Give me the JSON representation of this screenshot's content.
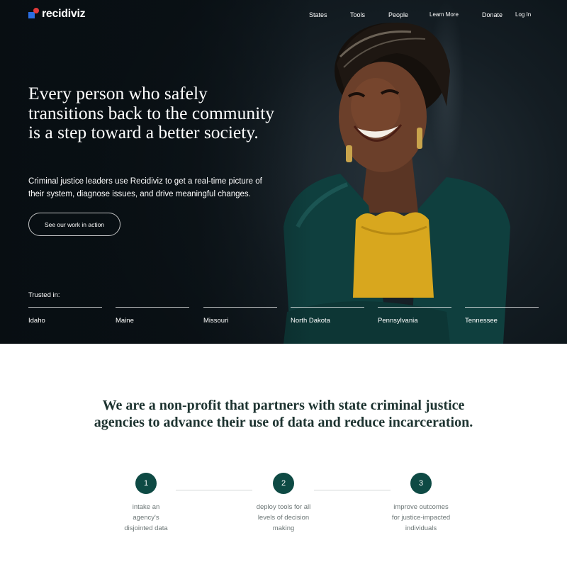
{
  "brand": {
    "name": "recidiviz",
    "colors": {
      "blue": "#2b6de0",
      "red": "#e13a3a"
    }
  },
  "nav": {
    "items": [
      {
        "label": "States"
      },
      {
        "label": "Tools"
      },
      {
        "label": "People"
      },
      {
        "label": "Learn More"
      },
      {
        "label": "Donate"
      },
      {
        "label": "Log In"
      }
    ]
  },
  "hero": {
    "headline": "Every person who safely transitions back to the community is a step toward a better society.",
    "subtext": "Criminal justice leaders use Recidiviz to get a real-time picture of their system, diagnose issues, and drive meaningful changes.",
    "cta_label": "See our work in action",
    "trusted_label": "Trusted in:",
    "states": [
      "Idaho",
      "Maine",
      "Missouri",
      "North Dakota",
      "Pennsylvania",
      "Tennessee"
    ]
  },
  "mission": {
    "statement": "We are a non-profit that partners with state criminal justice agencies to advance their use of data and reduce incarceration.",
    "accent_color": "#0e4a44",
    "steps": [
      {
        "number": "1",
        "text": "intake an agency's disjointed data"
      },
      {
        "number": "2",
        "text": "deploy tools for all levels of decision making"
      },
      {
        "number": "3",
        "text": "improve outcomes for justice-impacted individuals"
      }
    ]
  }
}
